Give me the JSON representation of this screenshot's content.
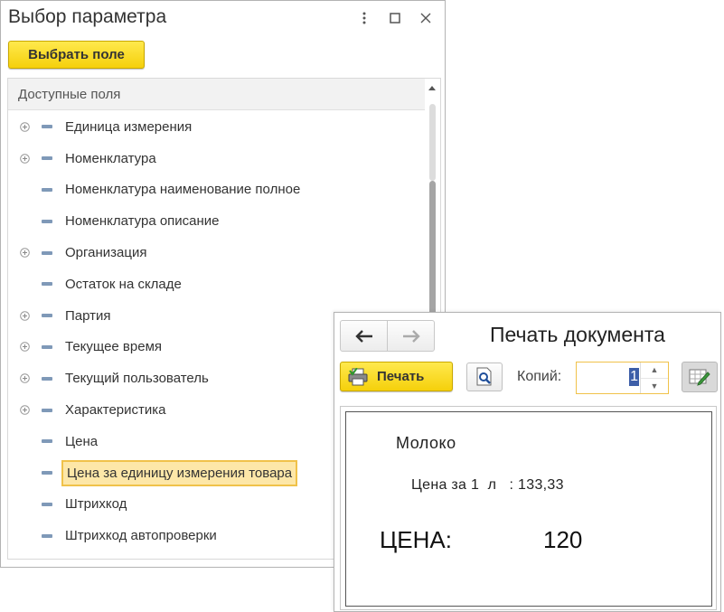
{
  "param_window": {
    "title": "Выбор параметра",
    "choose_button": "Выбрать поле",
    "list_header": "Доступные поля",
    "items": [
      {
        "label": "Единица измерения",
        "expandable": true
      },
      {
        "label": "Номенклатура",
        "expandable": true
      },
      {
        "label": "Номенклатура наименование полное",
        "expandable": false
      },
      {
        "label": "Номенклатура описание",
        "expandable": false
      },
      {
        "label": "Организация",
        "expandable": true
      },
      {
        "label": "Остаток на складе",
        "expandable": false
      },
      {
        "label": "Партия",
        "expandable": true
      },
      {
        "label": "Текущее время",
        "expandable": true
      },
      {
        "label": "Текущий пользователь",
        "expandable": true
      },
      {
        "label": "Характеристика",
        "expandable": true
      },
      {
        "label": "Цена",
        "expandable": false
      },
      {
        "label": "Цена за единицу измерения товара",
        "expandable": false,
        "selected": true
      },
      {
        "label": "Штрихкод",
        "expandable": false
      },
      {
        "label": "Штрихкод автопроверки",
        "expandable": false
      }
    ],
    "title_icons": [
      "more-vertical-icon",
      "maximize-icon",
      "close-icon"
    ]
  },
  "print_window": {
    "title": "Печать документа",
    "print_button": "Печать",
    "copies_label": "Копий:",
    "copies_value": "1",
    "document": {
      "product": "Молоко",
      "unit_price_line": "Цена за 1  л   : 133,33",
      "price_label": "ЦЕНА:",
      "price_value": "120"
    }
  },
  "colors": {
    "accent_yellow": "#f5d00b",
    "selection_fill": "#fde7a8",
    "selection_border": "#f0c24a",
    "field_dash": "#7f99b8"
  }
}
